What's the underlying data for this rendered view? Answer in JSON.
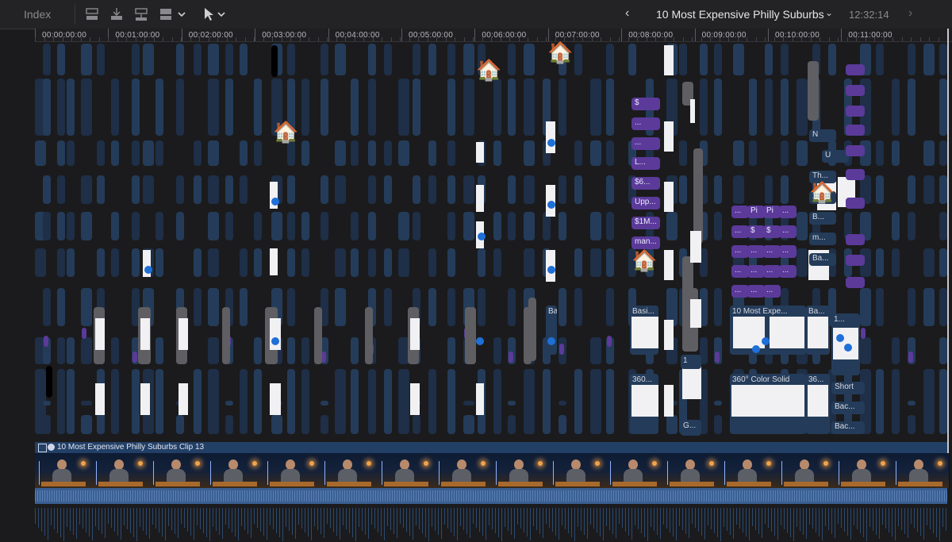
{
  "toolbar": {
    "index_label": "Index",
    "project_title": "10 Most Expensive Philly Suburbs",
    "timecode": "12:32:14"
  },
  "ruler": {
    "labels": [
      "00:00:00:00",
      "00:01:00:00",
      "00:02:00:00",
      "00:03:00:00",
      "00:04:00:00",
      "00:05:00:00",
      "00:06:00:00",
      "00:07:00:00",
      "00:08:00:00",
      "00:09:00:00",
      "00:10:00:00",
      "00:11:00:00"
    ]
  },
  "clips": {
    "pills_col_a": [
      "$",
      "...",
      "...",
      "L...",
      "$6...",
      "Upp...",
      "$1M...",
      "man..."
    ],
    "pills_col_c": [
      "...",
      "Pi",
      "Pi",
      "...",
      "...",
      "$",
      "$",
      "...",
      "...",
      "...",
      "...",
      "...",
      "...",
      "...",
      "...",
      "...",
      "...",
      "...",
      "..."
    ],
    "titles_top": [
      "10 Most Expe...",
      "Ba...",
      "Basi...",
      "Ba...",
      "1..."
    ],
    "right_col": [
      "Short",
      "Bac...",
      "Bac..."
    ],
    "bottom_titles": [
      "360...",
      "360° Color Solid",
      "36...",
      "G...",
      "1"
    ],
    "small_right": [
      "N",
      "U",
      "Th...",
      "2-...",
      "B...",
      "m...",
      "Ba..."
    ]
  },
  "main_clip": {
    "title": "10 Most Expensive Philly Suburbs Clip 13"
  }
}
